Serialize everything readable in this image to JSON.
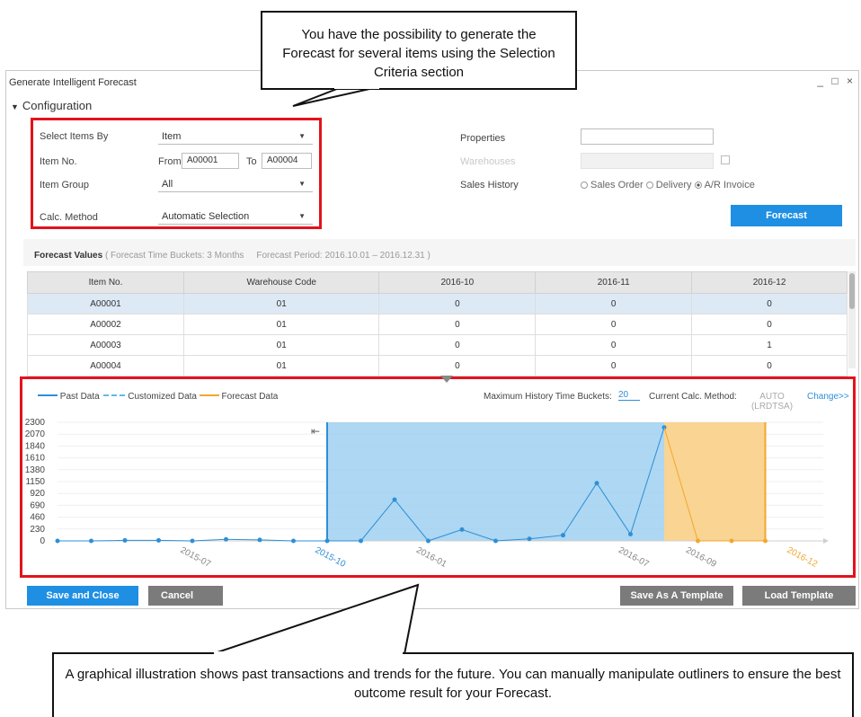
{
  "callout_top": {
    "text": "You have the possibility to generate the Forecast for several items using the Selection Criteria section"
  },
  "callout_bottom": {
    "text": "A graphical illustration shows past transactions and trends for the future. You can manually manipulate outliners to ensure the best outcome result for your Forecast."
  },
  "window": {
    "title": "Generate Intelligent Forecast",
    "controls": "_ □ ×"
  },
  "config": {
    "section_label": "Configuration",
    "select_items_by_label": "Select Items By",
    "select_items_by_value": "Item",
    "item_no_label": "Item No.",
    "from_label": "From",
    "from_value": "A00001",
    "to_label": "To",
    "to_value": "A00004",
    "item_group_label": "Item Group",
    "item_group_value": "All",
    "calc_method_label": "Calc. Method",
    "calc_method_value": "Automatic Selection",
    "properties_label": "Properties",
    "properties_value": "",
    "warehouses_label": "Warehouses",
    "sales_history_label": "Sales History",
    "sales_history_options": [
      "Sales Order",
      "Delivery",
      "A/R Invoice"
    ],
    "sales_history_selected": "A/R Invoice",
    "forecast_button": "Forecast"
  },
  "forecast_values": {
    "title": "Forecast Values",
    "time_buckets": "( Forecast Time Buckets: 3 Months",
    "period": "Forecast Period: 2016.10.01 – 2016.12.31 )",
    "columns": [
      "Item No.",
      "Warehouse Code",
      "2016-10",
      "2016-11",
      "2016-12"
    ],
    "rows": [
      [
        "A00001",
        "01",
        "0",
        "0",
        "0"
      ],
      [
        "A00002",
        "01",
        "0",
        "0",
        "0"
      ],
      [
        "A00003",
        "01",
        "0",
        "0",
        "1"
      ],
      [
        "A00004",
        "01",
        "0",
        "0",
        "0"
      ]
    ]
  },
  "chart_header": {
    "legend_past": "Past Data",
    "legend_customized": "Customized Data",
    "legend_forecast": "Forecast Data",
    "max_history_label": "Maximum History Time Buckets:",
    "max_history_value": "20",
    "current_calc_label": "Current Calc. Method:",
    "current_calc_value_1": "AUTO",
    "current_calc_value_2": "(LRDTSA)",
    "change_link": "Change>>"
  },
  "chart_data": {
    "type": "line",
    "yticks": [
      2300,
      2070,
      1840,
      1610,
      1380,
      1150,
      920,
      690,
      460,
      230,
      0
    ],
    "ylim": [
      0,
      2300
    ],
    "xtick_labels": [
      "2015-07",
      "2015-10",
      "2016-01",
      "2016-07",
      "2016-09",
      "2016-12"
    ],
    "series": [
      {
        "name": "Past Data",
        "color": "#2e8fd6",
        "values": [
          0,
          0,
          10,
          10,
          0,
          30,
          20,
          0,
          0,
          0,
          800,
          0,
          220,
          0,
          40,
          110,
          1120,
          130,
          2200
        ]
      },
      {
        "name": "Forecast Data",
        "color": "#f0a830",
        "values": [
          2200,
          0,
          0,
          0
        ]
      }
    ],
    "colors": {
      "past_fill": "#9fd0f0",
      "forecast_fill": "#f8cf86"
    }
  },
  "buttons": {
    "save_close": "Save and Close",
    "cancel": "Cancel",
    "save_template": "Save As A Template",
    "load_template": "Load Template"
  }
}
